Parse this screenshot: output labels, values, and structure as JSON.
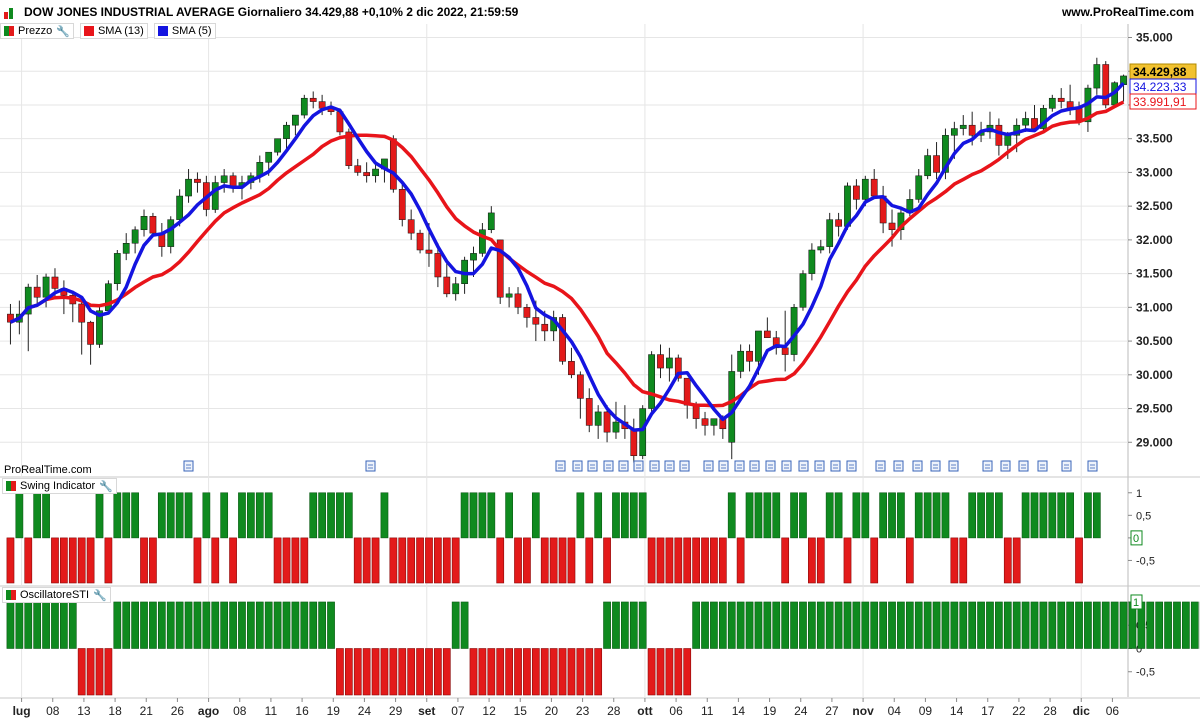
{
  "header": {
    "title": "DOW JONES INDUSTRIAL AVERAGE Giornaliero 34.429,88 +0,10% 2 dic 2022, 21:59:59",
    "site": "www.ProRealTime.com",
    "watermark": "ProRealTime.com"
  },
  "legend": {
    "price_label": "Prezzo",
    "sma13_label": "SMA (13)",
    "sma5_label": "SMA (5)"
  },
  "colors": {
    "up": "#0f8a1f",
    "down": "#e31a1a",
    "sma13": "#e8141a",
    "sma5": "#1414e0",
    "grid": "#e6e6e6",
    "price_tag": "#f2c230"
  },
  "price_tags": {
    "last": "34.429,88",
    "sma5": "34.223,33",
    "sma13": "33.991,91"
  },
  "panels": {
    "swing_label": "Swing Indicator",
    "sti_label": "OscillatoreSTI",
    "swing_current": "0",
    "sti_current": "1"
  },
  "icons": {
    "wrench": "wrench-icon",
    "news": "document-icon"
  },
  "price_axis_ticks": [
    "35.000",
    "34.500",
    "34.000",
    "33.500",
    "33.000",
    "32.500",
    "32.000",
    "31.500",
    "31.000",
    "30.500",
    "30.000",
    "29.500",
    "29.000"
  ],
  "swing_axis_ticks": [
    "1",
    "0,5",
    "0",
    "-0,5"
  ],
  "sti_axis_ticks": [
    "1",
    "0,5",
    "0",
    "-0,5"
  ],
  "x_axis_labels": [
    "lug",
    "08",
    "13",
    "18",
    "21",
    "26",
    "ago",
    "08",
    "11",
    "16",
    "19",
    "24",
    "29",
    "set",
    "07",
    "12",
    "15",
    "20",
    "23",
    "28",
    "ott",
    "06",
    "11",
    "14",
    "19",
    "24",
    "27",
    "nov",
    "04",
    "09",
    "14",
    "17",
    "22",
    "28",
    "dic",
    "06"
  ],
  "x_axis_bold": [
    "lug",
    "ago",
    "set",
    "ott",
    "nov",
    "dic"
  ],
  "chart_data": {
    "type": "candlestick",
    "title": "DOW JONES INDUSTRIAL AVERAGE Giornaliero",
    "ylim": [
      28500,
      35200
    ],
    "ohlc": [
      [
        30900,
        31050,
        30450,
        30780
      ],
      [
        30780,
        31100,
        30600,
        30900
      ],
      [
        30900,
        31350,
        30350,
        31300
      ],
      [
        31300,
        31480,
        31050,
        31150
      ],
      [
        31150,
        31500,
        31000,
        31450
      ],
      [
        31450,
        31580,
        31150,
        31280
      ],
      [
        31280,
        31400,
        30900,
        31180
      ],
      [
        31180,
        31250,
        30780,
        31050
      ],
      [
        31050,
        31080,
        30300,
        30780
      ],
      [
        30780,
        30800,
        30150,
        30450
      ],
      [
        30450,
        31000,
        30400,
        30950
      ],
      [
        30950,
        31400,
        30900,
        31350
      ],
      [
        31350,
        31850,
        31250,
        31800
      ],
      [
        31800,
        32100,
        31700,
        31950
      ],
      [
        31950,
        32200,
        31800,
        32150
      ],
      [
        32150,
        32450,
        32050,
        32350
      ],
      [
        32350,
        32400,
        32050,
        32100
      ],
      [
        32100,
        32250,
        31750,
        31900
      ],
      [
        31900,
        32350,
        31800,
        32300
      ],
      [
        32300,
        32750,
        32200,
        32650
      ],
      [
        32650,
        33050,
        32550,
        32900
      ],
      [
        32900,
        33000,
        32700,
        32850
      ],
      [
        32850,
        32950,
        32350,
        32450
      ],
      [
        32450,
        32950,
        32400,
        32850
      ],
      [
        32850,
        33050,
        32700,
        32950
      ],
      [
        32950,
        33000,
        32700,
        32800
      ],
      [
        32800,
        32950,
        32600,
        32850
      ],
      [
        32850,
        33000,
        32750,
        32950
      ],
      [
        32950,
        33250,
        32850,
        33150
      ],
      [
        33150,
        33250,
        32950,
        33300
      ],
      [
        33300,
        33500,
        33250,
        33500
      ],
      [
        33500,
        33750,
        33350,
        33700
      ],
      [
        33700,
        33850,
        33550,
        33850
      ],
      [
        33850,
        34150,
        33800,
        34100
      ],
      [
        34100,
        34200,
        33950,
        34050
      ],
      [
        34050,
        34150,
        33850,
        33950
      ],
      [
        33950,
        34050,
        33850,
        33900
      ],
      [
        33900,
        33950,
        33550,
        33600
      ],
      [
        33600,
        33650,
        33050,
        33100
      ],
      [
        33100,
        33200,
        32950,
        33000
      ],
      [
        33000,
        33150,
        32850,
        32950
      ],
      [
        32950,
        33150,
        32850,
        33050
      ],
      [
        33050,
        33150,
        32850,
        33200
      ],
      [
        33500,
        33550,
        32700,
        32750
      ],
      [
        32750,
        32850,
        32200,
        32300
      ],
      [
        32300,
        32450,
        32000,
        32100
      ],
      [
        32100,
        32150,
        31800,
        31850
      ],
      [
        31850,
        32250,
        31600,
        31800
      ],
      [
        31800,
        31950,
        31300,
        31450
      ],
      [
        31450,
        31700,
        31150,
        31200
      ],
      [
        31200,
        31450,
        31100,
        31350
      ],
      [
        31350,
        31750,
        31200,
        31700
      ],
      [
        31700,
        31900,
        31450,
        31800
      ],
      [
        31800,
        32250,
        31750,
        32150
      ],
      [
        32150,
        32500,
        32100,
        32400
      ],
      [
        32000,
        32000,
        31050,
        31150
      ],
      [
        31150,
        31300,
        31000,
        31200
      ],
      [
        31200,
        31300,
        30900,
        31000
      ],
      [
        31000,
        31050,
        30700,
        30850
      ],
      [
        30850,
        31100,
        30500,
        30750
      ],
      [
        30750,
        30950,
        30500,
        30650
      ],
      [
        30650,
        30950,
        30500,
        30850
      ],
      [
        30850,
        30900,
        30150,
        30200
      ],
      [
        30200,
        30400,
        29950,
        30000
      ],
      [
        30000,
        30050,
        29350,
        29650
      ],
      [
        29650,
        29800,
        29150,
        29250
      ],
      [
        29250,
        29550,
        29050,
        29450
      ],
      [
        29450,
        29550,
        29000,
        29150
      ],
      [
        29150,
        29600,
        29050,
        29300
      ],
      [
        29300,
        29550,
        29050,
        29200
      ],
      [
        29200,
        29350,
        28700,
        28800
      ],
      [
        28800,
        29550,
        28750,
        29500
      ],
      [
        29500,
        30350,
        29450,
        30300
      ],
      [
        30300,
        30450,
        29950,
        30100
      ],
      [
        30100,
        30400,
        29900,
        30250
      ],
      [
        30250,
        30300,
        29900,
        29950
      ],
      [
        29950,
        29950,
        29350,
        29550
      ],
      [
        29550,
        29600,
        29200,
        29350
      ],
      [
        29350,
        29450,
        29100,
        29250
      ],
      [
        29250,
        29300,
        29100,
        29350
      ],
      [
        29350,
        29400,
        29050,
        29200
      ],
      [
        29000,
        30300,
        28750,
        30050
      ],
      [
        30050,
        30450,
        29950,
        30350
      ],
      [
        30350,
        30450,
        30050,
        30200
      ],
      [
        30200,
        30550,
        30000,
        30650
      ],
      [
        30650,
        30850,
        30550,
        30550
      ],
      [
        30550,
        30650,
        30300,
        30400
      ],
      [
        30400,
        30950,
        30050,
        30300
      ],
      [
        30300,
        31050,
        30200,
        31000
      ],
      [
        31000,
        31550,
        30950,
        31500
      ],
      [
        31500,
        31950,
        31400,
        31850
      ],
      [
        31850,
        32000,
        31800,
        31900
      ],
      [
        31900,
        32400,
        31800,
        32300
      ],
      [
        32300,
        32400,
        32050,
        32200
      ],
      [
        32200,
        32850,
        32150,
        32800
      ],
      [
        32800,
        32900,
        32450,
        32600
      ],
      [
        32600,
        32950,
        32500,
        32900
      ],
      [
        32900,
        33050,
        32700,
        32650
      ],
      [
        32650,
        32800,
        32100,
        32250
      ],
      [
        32250,
        32450,
        31900,
        32150
      ],
      [
        32150,
        32450,
        32000,
        32400
      ],
      [
        32400,
        32750,
        32350,
        32600
      ],
      [
        32600,
        33050,
        32550,
        32950
      ],
      [
        32950,
        33350,
        32900,
        33250
      ],
      [
        33250,
        33450,
        32900,
        33000
      ],
      [
        33000,
        33650,
        32900,
        33550
      ],
      [
        33550,
        33750,
        33200,
        33650
      ],
      [
        33650,
        33850,
        33550,
        33700
      ],
      [
        33700,
        33900,
        33400,
        33550
      ],
      [
        33550,
        33750,
        33450,
        33600
      ],
      [
        33600,
        33900,
        33500,
        33700
      ],
      [
        33700,
        33800,
        33250,
        33400
      ],
      [
        33400,
        33600,
        33200,
        33550
      ],
      [
        33550,
        33800,
        33300,
        33700
      ],
      [
        33700,
        33900,
        33600,
        33800
      ],
      [
        33800,
        34000,
        33600,
        33650
      ],
      [
        33650,
        34000,
        33600,
        33950
      ],
      [
        33950,
        34150,
        33900,
        34100
      ],
      [
        34100,
        34250,
        33950,
        34050
      ],
      [
        34050,
        34300,
        33850,
        33950
      ],
      [
        33950,
        34050,
        33700,
        33750
      ],
      [
        33750,
        34300,
        33600,
        34250
      ],
      [
        34250,
        34700,
        34150,
        34600
      ],
      [
        34600,
        34650,
        33950,
        34000
      ],
      [
        34000,
        34350,
        34050,
        34330
      ],
      [
        34300,
        34450,
        34050,
        34430
      ]
    ],
    "sma13_label": "SMA (13)",
    "sma5_label": "SMA (5)",
    "swing": [
      -1,
      1,
      -1,
      1,
      1,
      -1,
      -1,
      -1,
      -1,
      -1,
      1,
      -1,
      1,
      1,
      1,
      -1,
      -1,
      1,
      1,
      1,
      1,
      -1,
      1,
      -1,
      1,
      -1,
      1,
      1,
      1,
      1,
      -1,
      -1,
      -1,
      -1,
      1,
      1,
      1,
      1,
      1,
      -1,
      -1,
      -1,
      1,
      -1,
      -1,
      -1,
      -1,
      -1,
      -1,
      -1,
      -1,
      1,
      1,
      1,
      1,
      -1,
      1,
      -1,
      -1,
      1,
      -1,
      -1,
      -1,
      -1,
      1,
      -1,
      1,
      -1,
      1,
      1,
      1,
      1,
      -1,
      -1,
      -1,
      -1,
      -1,
      -1,
      -1,
      -1,
      -1,
      1,
      -1,
      1,
      1,
      1,
      1,
      -1,
      1,
      1,
      -1,
      -1,
      1,
      1,
      -1,
      1,
      1,
      -1,
      1,
      1,
      1,
      -1,
      1,
      1,
      1,
      1,
      -1,
      -1,
      1,
      1,
      1,
      1,
      -1,
      -1,
      1,
      1,
      1,
      1,
      1,
      1,
      -1,
      1,
      1
    ],
    "sti": [
      1,
      1,
      1,
      1,
      1,
      1,
      1,
      1,
      -1,
      -1,
      -1,
      -1,
      1,
      1,
      1,
      1,
      1,
      1,
      1,
      1,
      1,
      1,
      1,
      1,
      1,
      1,
      1,
      1,
      1,
      1,
      1,
      1,
      1,
      1,
      1,
      1,
      1,
      -1,
      -1,
      -1,
      -1,
      -1,
      -1,
      -1,
      -1,
      -1,
      -1,
      -1,
      -1,
      -1,
      1,
      1,
      -1,
      -1,
      -1,
      -1,
      -1,
      -1,
      -1,
      -1,
      -1,
      -1,
      -1,
      -1,
      -1,
      -1,
      -1,
      1,
      1,
      1,
      1,
      1,
      -1,
      -1,
      -1,
      -1,
      -1,
      1,
      1,
      1,
      1,
      1,
      1,
      1,
      1,
      1,
      1,
      1,
      1,
      1,
      1,
      1,
      1,
      1,
      1,
      1,
      1,
      1,
      1,
      1,
      1,
      1,
      1,
      1,
      1,
      1,
      1,
      1,
      1,
      1,
      1,
      1,
      1,
      1,
      1,
      1,
      1,
      1,
      1,
      1,
      1,
      1,
      1,
      1,
      1,
      1,
      1,
      1,
      1,
      1,
      1,
      1,
      1,
      1,
      1,
      1,
      1,
      1,
      1,
      1
    ]
  }
}
